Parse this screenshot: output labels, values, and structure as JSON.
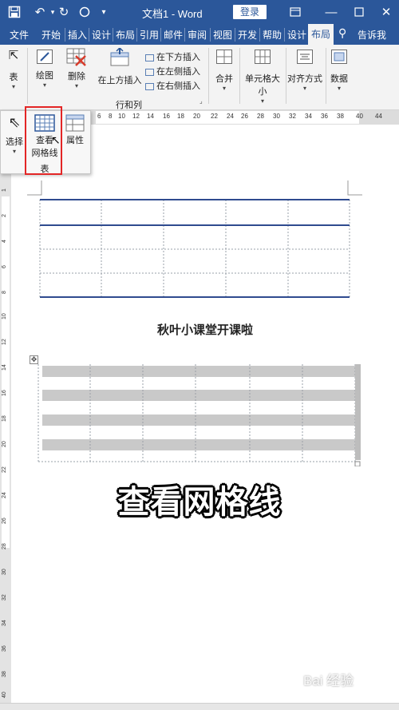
{
  "titlebar": {
    "doc_title": "文档1 - Word",
    "login": "登录"
  },
  "tabs": [
    "文件",
    "开始",
    "插入",
    "设计",
    "布局",
    "引用",
    "邮件",
    "审阅",
    "视图",
    "开发",
    "帮助",
    "设计"
  ],
  "active_tab": "布局",
  "tell_me": "告诉我",
  "ribbon": {
    "table_label": "表",
    "draw_label": "绘图",
    "delete_label": "删除",
    "insert_above": "在上方插入",
    "insert_below": "在下方插入",
    "insert_left": "在左侧插入",
    "insert_right": "在右侧插入",
    "rows_cols_group": "行和列",
    "merge": "合并",
    "cell_size": "单元格大小",
    "alignment": "对齐方式",
    "data": "数据"
  },
  "ruler_ticks": [
    "6",
    "8",
    "10",
    "12",
    "14",
    "16",
    "18",
    "20",
    "22",
    "24",
    "26",
    "28",
    "30",
    "32",
    "34",
    "36",
    "38",
    "40",
    "44"
  ],
  "vruler_ticks": [
    "1",
    "2",
    "4",
    "6",
    "8",
    "10",
    "12",
    "14",
    "16",
    "18",
    "20",
    "22",
    "24",
    "26",
    "28",
    "30",
    "32",
    "34",
    "36",
    "38",
    "40",
    "42"
  ],
  "popup": {
    "select": "选择",
    "view_gridlines_line1": "查看",
    "view_gridlines_line2": "网格线",
    "properties": "属性",
    "group": "表"
  },
  "caption": "秋叶小课堂开课啦",
  "overlay": "查看网格线",
  "watermark": "Bai 经验"
}
